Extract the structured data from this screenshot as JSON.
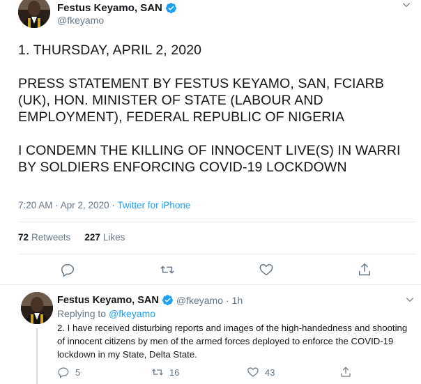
{
  "main_tweet": {
    "author": {
      "name": "Festus Keyamo, SAN",
      "handle": "@fkeyamo"
    },
    "paragraphs": [
      "1. THURSDAY, APRIL 2, 2020",
      "PRESS STATEMENT BY FESTUS KEYAMO, SAN, FCIARB (UK), HON. MINISTER OF STATE (LABOUR AND EMPLOYMENT), FEDERAL REPUBLIC OF NIGERIA",
      "I CONDEMN THE KILLING OF INNOCENT LIVE(S) IN WARRI BY SOLDIERS ENFORCING COVID-19 LOCKDOWN"
    ],
    "timestamp": "7:20 AM · Apr 2, 2020 · ",
    "source": "Twitter for iPhone",
    "retweets_count": "72",
    "retweets_label": "Retweets",
    "likes_count": "227",
    "likes_label": "Likes",
    "icons": [
      "reply-icon",
      "retweet-icon",
      "like-icon",
      "share-icon"
    ]
  },
  "reply_tweet": {
    "author": {
      "name": "Festus Keyamo, SAN",
      "handle": "@fkeyamo",
      "separator": "·",
      "age": "1h"
    },
    "replying_to_label": "Replying to",
    "replying_to_handle": "@fkeyamo",
    "text": "2. I have received disturbing reports and images of the high-handedness and shooting of innocent citizens by men of the armed forces deployed to enforce the COVID-19 lockdown in my State, Delta State.",
    "reply_count": "5",
    "retweet_count": "16",
    "like_count": "43"
  },
  "colors": {
    "accent": "#1da1f2",
    "secondary_text": "#657786",
    "primary_text": "#14171a",
    "divider": "#e6ecf0",
    "verified": "#1da1f2"
  }
}
